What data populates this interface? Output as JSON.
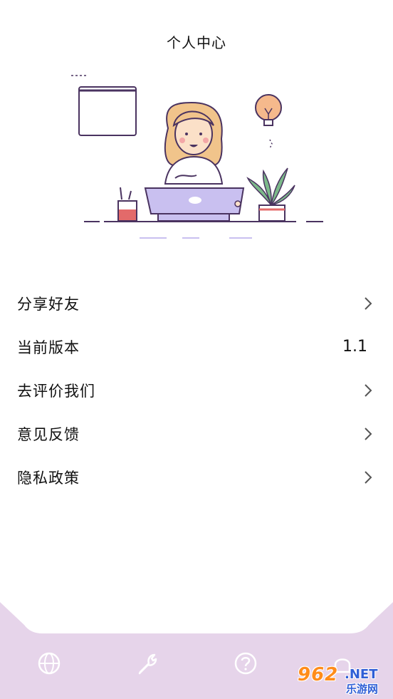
{
  "header": {
    "title": "个人中心"
  },
  "menu": {
    "items": [
      {
        "label": "分享好友",
        "icon": "chevron-right-icon"
      },
      {
        "label": "当前版本",
        "value": "1.1"
      },
      {
        "label": "去评价我们",
        "icon": "chevron-right-icon"
      },
      {
        "label": "意见反馈",
        "icon": "chevron-right-icon"
      },
      {
        "label": "隐私政策",
        "icon": "chevron-right-icon"
      }
    ]
  },
  "tabbar": {
    "background": "#e6d4ea",
    "icon_color": "#ffffff",
    "tabs": [
      {
        "icon": "globe-icon"
      },
      {
        "icon": "wrench-icon"
      },
      {
        "icon": "help-circle-icon"
      },
      {
        "icon": "profile-icon"
      }
    ]
  },
  "watermark": {
    "brand": "962",
    "domain": ".NET",
    "sub": "乐游网"
  },
  "colors": {
    "laptop": "#c9c0f0",
    "outline": "#4a3360",
    "hair": "#f1c48b",
    "plant": "#7cb98a",
    "pot": "#e36a6a",
    "bulb": "#f5b98c"
  }
}
